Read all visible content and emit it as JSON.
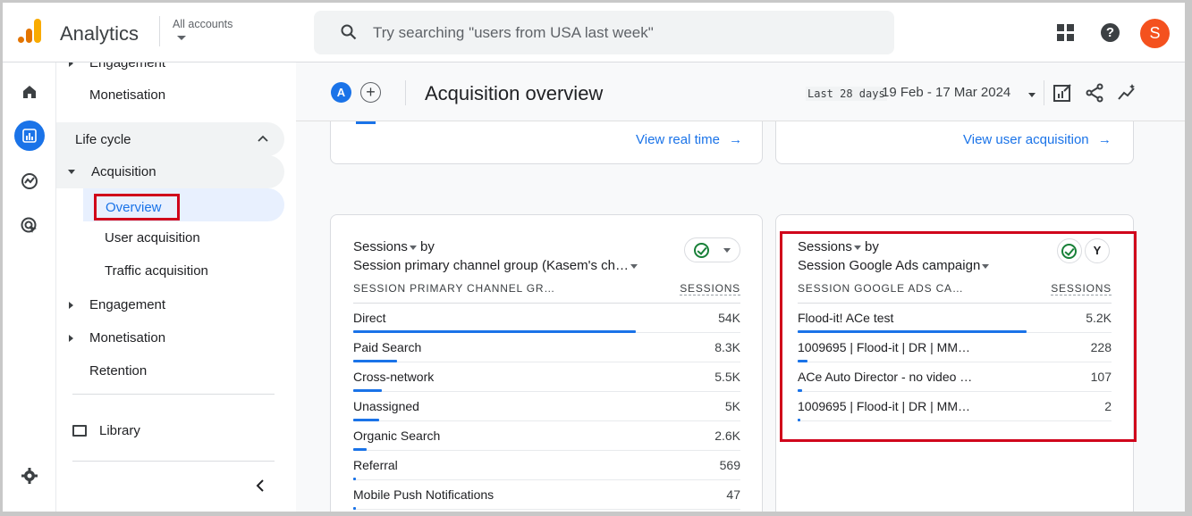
{
  "topbar": {
    "app_name": "Analytics",
    "account_selector": "All accounts",
    "search_placeholder": "Try searching \"users from USA last week\"",
    "avatar_letter": "S"
  },
  "sidebar": {
    "partial_top_item": "Engagement",
    "items": {
      "monetisation_top": "Monetisation",
      "lifecycle": "Life cycle",
      "acquisition": "Acquisition",
      "overview": "Overview",
      "user_acquisition": "User acquisition",
      "traffic_acquisition": "Traffic acquisition",
      "engagement": "Engagement",
      "monetisation": "Monetisation",
      "retention": "Retention",
      "library": "Library"
    }
  },
  "header": {
    "segment_letter": "A",
    "title": "Acquisition overview",
    "date_label": "Last 28 days",
    "date_range": "19 Feb - 17 Mar 2024"
  },
  "top_cards": {
    "left_link": "View real time",
    "right_link": "View user acquisition"
  },
  "left_card": {
    "metric": "Sessions",
    "by": "by",
    "dimension": "Session primary channel group (Kasem's ch…",
    "col_dimension": "SESSION PRIMARY CHANNEL GR…",
    "col_metric": "SESSIONS",
    "rows": [
      {
        "label": "Direct",
        "value": "54K",
        "bar": 1.0
      },
      {
        "label": "Paid Search",
        "value": "8.3K",
        "bar": 0.154
      },
      {
        "label": "Cross-network",
        "value": "5.5K",
        "bar": 0.102
      },
      {
        "label": "Unassigned",
        "value": "5K",
        "bar": 0.093
      },
      {
        "label": "Organic Search",
        "value": "2.6K",
        "bar": 0.048
      },
      {
        "label": "Referral",
        "value": "569",
        "bar": 0.011
      },
      {
        "label": "Mobile Push Notifications",
        "value": "47",
        "bar": 0.001
      }
    ]
  },
  "right_card": {
    "metric": "Sessions",
    "by": "by",
    "dimension": "Session Google Ads campaign",
    "col_dimension": "SESSION GOOGLE ADS CA…",
    "col_metric": "SESSIONS",
    "filter_glyph": "Y",
    "rows": [
      {
        "label": "Flood-it! ACe test",
        "value": "5.2K",
        "bar": 1.0
      },
      {
        "label": "1009695 | Flood-it | DR | MM…",
        "value": "228",
        "bar": 0.044
      },
      {
        "label": "ACe Auto Director - no video …",
        "value": "107",
        "bar": 0.021
      },
      {
        "label": "1009695 | Flood-it | DR | MM…",
        "value": "2",
        "bar": 0.001
      }
    ]
  },
  "colors": {
    "accent": "#1a73e8",
    "highlight": "#d0021b",
    "avatar": "#f4511e",
    "logo_orange": "#e37400",
    "logo_yellow": "#f9ab00",
    "check_green": "#188038"
  }
}
